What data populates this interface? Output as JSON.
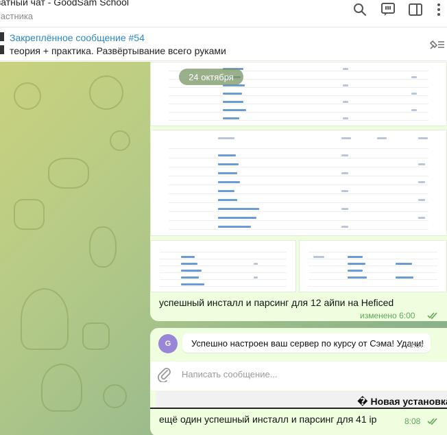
{
  "header": {
    "title": "ватный чат - GoodSam School",
    "subtitle": "частника",
    "icons": [
      "search-icon",
      "comments-icon",
      "sidebar-icon",
      "more-icon"
    ]
  },
  "pinned": {
    "title": "Закреплённое сообщение #54",
    "text": "теория + практика. Развёртывание всего руками",
    "icon": "pin-list-icon"
  },
  "chat": {
    "date_pill": "24 октября",
    "media_message": {
      "caption": "успешный инсталл и парсинг для 12 айпи на Heficed",
      "time": "изменено 6:00"
    },
    "bot_message": {
      "avatar_letter": "G",
      "text": "Успешно настроен ваш сервер по курсу от Сэма! Удачи!",
      "time": "8:07"
    },
    "compose": {
      "placeholder": "Написать сообщение..."
    },
    "new_install": "� Новая установка",
    "last_message": {
      "text": "ещё один успешный инсталл и парсинг для 41 ip",
      "time": "8:08"
    }
  },
  "colors": {
    "accent": "#2a87c8",
    "bubble": "#eefedf",
    "check_green": "#5ea85a",
    "avatar": "#9b85d6"
  }
}
